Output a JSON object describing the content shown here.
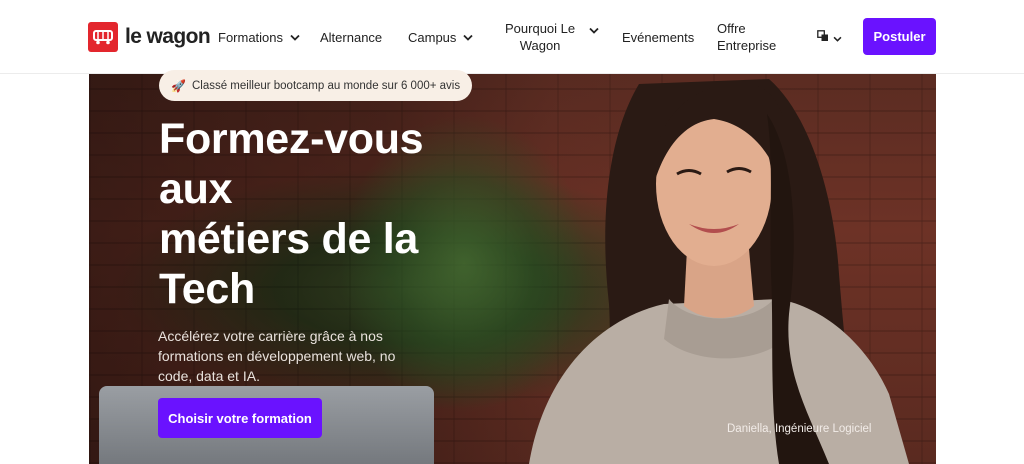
{
  "header": {
    "logo_text": "le wagon",
    "nav": {
      "formations": "Formations",
      "alternance": "Alternance",
      "campus": "Campus",
      "pourquoi_line1": "Pourquoi Le",
      "pourquoi_line2": "Wagon",
      "evenements": "Evénements",
      "offre_line1": "Offre",
      "offre_line2": "Entreprise",
      "language_icon": "translate-icon"
    },
    "cta_label": "Postuler"
  },
  "hero": {
    "badge": "Classé meilleur bootcamp au monde sur 6 000+ avis",
    "badge_icon": "rocket-icon",
    "headline_lines": [
      "Formez-vous",
      "aux",
      "métiers de la",
      "Tech"
    ],
    "subtext": "Accélérez votre carrière grâce à nos formations en développement web, no code, data et IA.",
    "cta_label": "Choisir votre formation",
    "photo_caption": "Daniella, Ingénieure Logiciel"
  },
  "colors": {
    "accent": "#6a12ff",
    "brand_red": "#e3262d"
  }
}
